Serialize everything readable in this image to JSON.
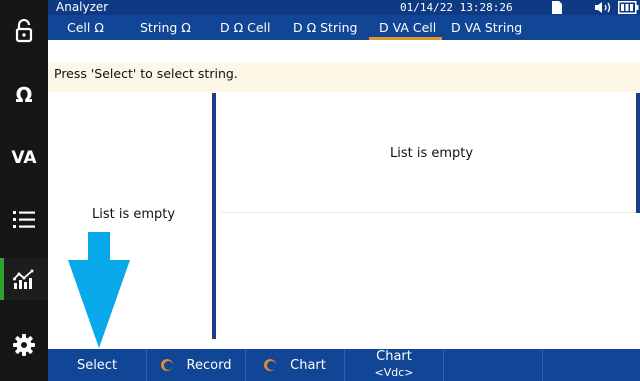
{
  "app": {
    "title": "Analyzer",
    "datetime": "01/14/22 13:28:26"
  },
  "status_icons": [
    "sd-card-icon",
    "speaker-icon",
    "battery-icon"
  ],
  "rail": {
    "items": [
      {
        "name": "lock-icon",
        "label": ""
      },
      {
        "name": "ohm",
        "label": "Ω"
      },
      {
        "name": "va",
        "label": "VA"
      },
      {
        "name": "list-icon",
        "label": ""
      },
      {
        "name": "chart-icon",
        "label": ""
      },
      {
        "name": "gear-icon",
        "label": ""
      }
    ]
  },
  "tabs": [
    {
      "label": "Cell Ω"
    },
    {
      "label": "String Ω"
    },
    {
      "label": "D Ω Cell"
    },
    {
      "label": "D Ω String"
    },
    {
      "label": "D VA Cell"
    },
    {
      "label": "D VA String"
    }
  ],
  "notice": "Press 'Select' to select string.",
  "left_panel": {
    "empty_text": "List is empty"
  },
  "right_panel": {
    "empty_text": "List is empty"
  },
  "softkeys": [
    {
      "label": "Select"
    },
    {
      "label": "Record"
    },
    {
      "label": "Chart"
    },
    {
      "line1": "Chart",
      "line2": "<Vdc>"
    },
    {
      "label": ""
    },
    {
      "label": ""
    }
  ],
  "colors": {
    "accent": "#e2962c",
    "bar": "#114595",
    "title_bar": "#0d3a83",
    "arrow": "#08a8ea",
    "rail_accent": "#2fa12f"
  }
}
